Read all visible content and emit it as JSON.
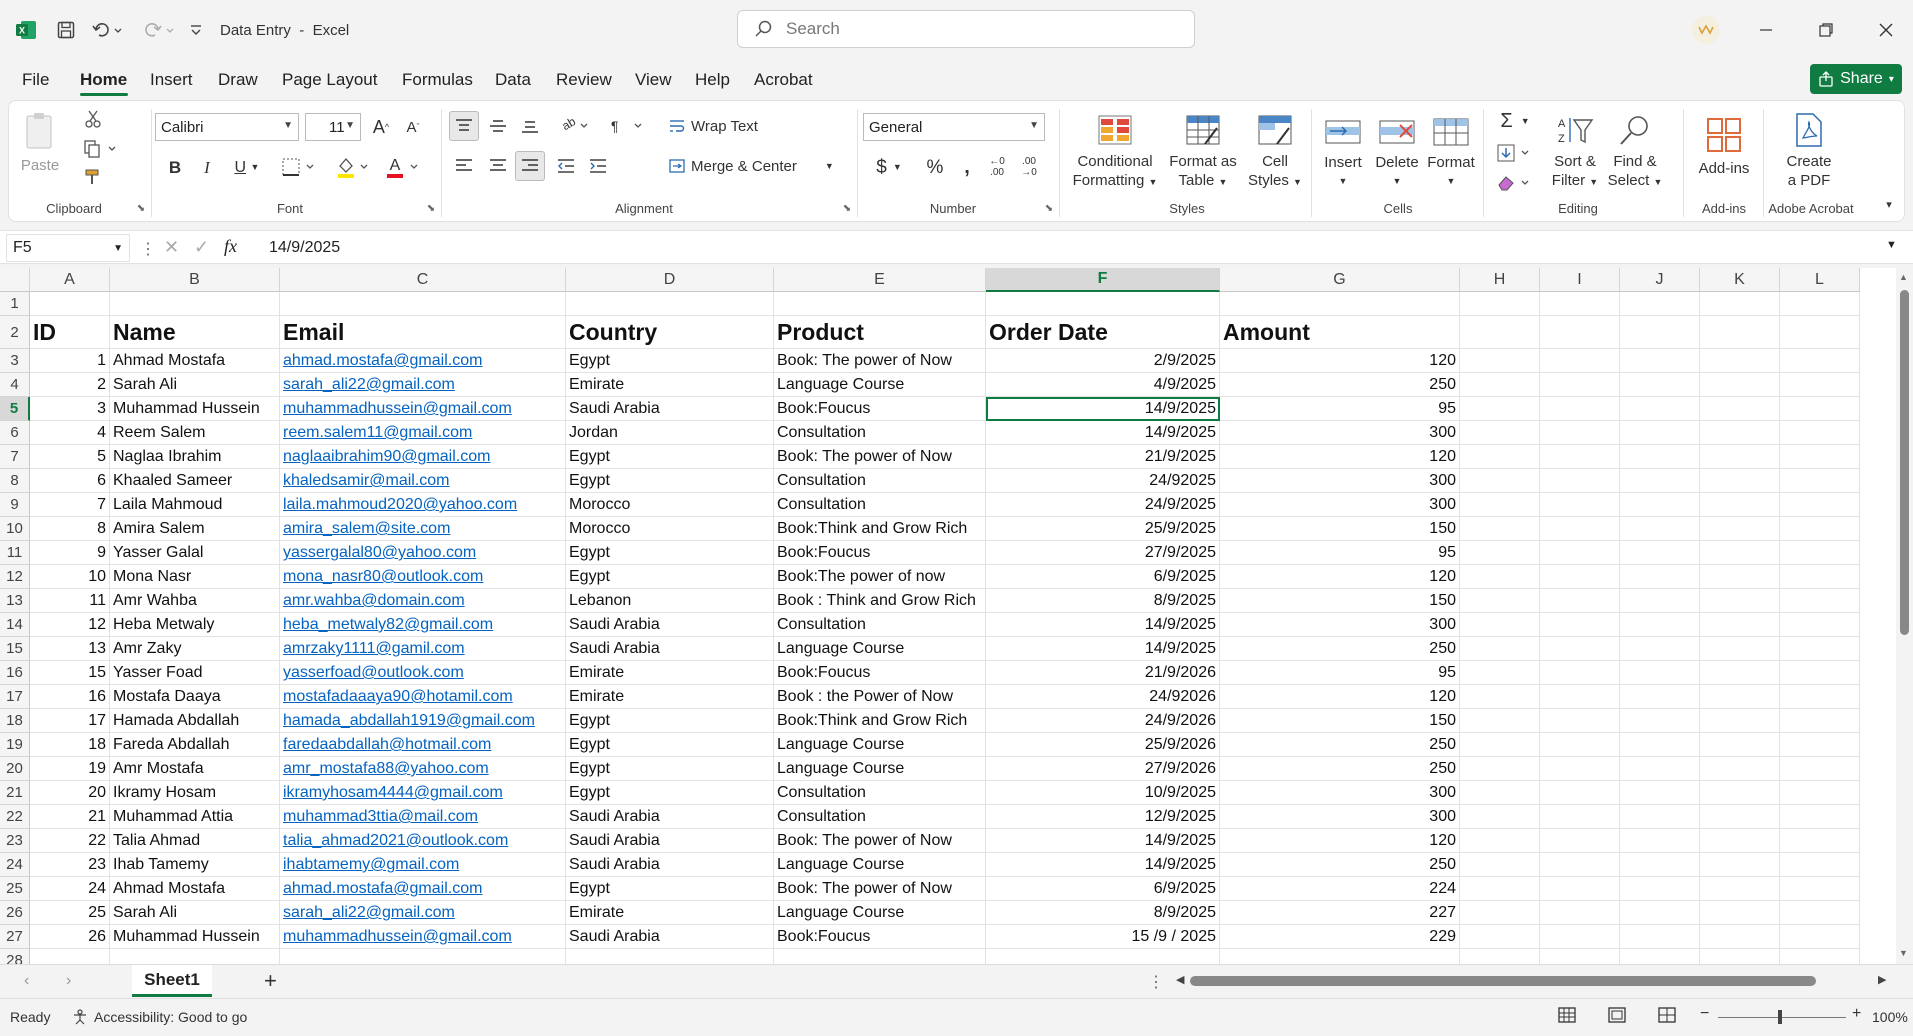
{
  "title_bar": {
    "doc_title": "Data Entry",
    "separator": "-",
    "app_name": "Excel",
    "search_placeholder": "Search"
  },
  "menu": {
    "tabs": [
      "File",
      "Home",
      "Insert",
      "Draw",
      "Page Layout",
      "Formulas",
      "Data",
      "Review",
      "View",
      "Help",
      "Acrobat"
    ],
    "active": "Home",
    "share_label": "Share"
  },
  "ribbon": {
    "clipboard": {
      "paste": "Paste",
      "label": "Clipboard"
    },
    "font": {
      "name": "Calibri",
      "size": "11",
      "label": "Font"
    },
    "alignment": {
      "wrap_text": "Wrap Text",
      "merge_center": "Merge & Center",
      "label": "Alignment"
    },
    "number": {
      "format": "General",
      "label": "Number"
    },
    "styles": {
      "conditional": "Conditional",
      "formatting": "Formatting",
      "format_as": "Format as",
      "table": "Table",
      "cell": "Cell",
      "styles_word": "Styles",
      "label": "Styles"
    },
    "cells": {
      "insert": "Insert",
      "delete": "Delete",
      "format": "Format",
      "label": "Cells"
    },
    "editing": {
      "sort": "Sort &",
      "filter": "Filter",
      "find": "Find &",
      "select": "Select",
      "label": "Editing"
    },
    "addins": {
      "addins": "Add-ins",
      "label": "Add-ins"
    },
    "acrobat": {
      "create": "Create",
      "pdf": "a PDF",
      "label": "Adobe Acrobat"
    }
  },
  "formula_bar": {
    "name_box": "F5",
    "fx": "fx",
    "formula": "14/9/2025"
  },
  "sheet": {
    "columns": [
      "A",
      "B",
      "C",
      "D",
      "E",
      "F",
      "G",
      "H",
      "I",
      "J",
      "K",
      "L"
    ],
    "selected_column": "F",
    "selected_row": 5,
    "header_row": [
      "ID",
      "Name",
      "Email",
      "Country",
      "Product",
      "Order Date",
      "Amount"
    ],
    "rows": [
      [
        "1",
        "Ahmad Mostafa",
        "ahmad.mostafa@gmail.com",
        "Egypt",
        "Book: The power of Now",
        "2/9/2025",
        "120"
      ],
      [
        "2",
        "Sarah Ali",
        "sarah_ali22@gmail.com",
        "Emirate",
        "Language Course",
        "4/9/2025",
        "250"
      ],
      [
        "3",
        "Muhammad Hussein",
        "muhammadhussein@gmail.com",
        "Saudi Arabia",
        "Book:Foucus",
        "14/9/2025",
        "95"
      ],
      [
        "4",
        "Reem Salem",
        "reem.salem11@gmail.com",
        "Jordan",
        "Consultation",
        "14/9/2025",
        "300"
      ],
      [
        "5",
        "Naglaa Ibrahim",
        "naglaaibrahim90@gmail.com",
        "Egypt",
        "Book: The power of Now",
        "21/9/2025",
        "120"
      ],
      [
        "6",
        "Khaaled Sameer",
        "khaledsamir@mail.com",
        "Egypt",
        "Consultation",
        "24/92025",
        "300"
      ],
      [
        "7",
        "Laila Mahmoud",
        "laila.mahmoud2020@yahoo.com",
        "Morocco",
        "Consultation",
        "24/9/2025",
        "300"
      ],
      [
        "8",
        "Amira Salem",
        "amira_salem@site.com",
        "Morocco",
        "Book:Think and Grow Rich",
        "25/9/2025",
        "150"
      ],
      [
        "9",
        "Yasser Galal",
        "yassergalal80@yahoo.com",
        "Egypt",
        "Book:Foucus",
        "27/9/2025",
        "95"
      ],
      [
        "10",
        "Mona Nasr",
        "mona_nasr80@outlook.com",
        "Egypt",
        "Book:The power of now",
        "6/9/2025",
        "120"
      ],
      [
        "11",
        "Amr Wahba",
        "amr.wahba@domain.com",
        "Lebanon",
        "Book : Think and Grow Rich",
        "8/9/2025",
        "150"
      ],
      [
        "12",
        "Heba Metwaly",
        "heba_metwaly82@gmail.com",
        "Saudi Arabia",
        "Consultation",
        "14/9/2025",
        "300"
      ],
      [
        "13",
        "Amr Zaky",
        "amrzaky1111@gamil.com",
        " Saudi Arabia",
        "Language Course",
        "14/9/2025",
        "250"
      ],
      [
        "15",
        "Yasser Foad",
        "yasserfoad@outlook.com",
        "Emirate",
        "Book:Foucus",
        "21/9/2026",
        "95"
      ],
      [
        "16",
        "Mostafa Daaya",
        "mostafadaaaya90@hotamil.com",
        "Emirate",
        "Book : the Power of Now",
        "24/92026",
        "120"
      ],
      [
        "17",
        "Hamada Abdallah",
        "hamada_abdallah1919@gmail.com",
        "Egypt",
        "Book:Think and Grow Rich",
        "24/9/2026",
        "150"
      ],
      [
        "18",
        "Fareda Abdallah",
        "faredaabdallah@hotmail.com",
        "Egypt",
        "Language Course",
        "25/9/2026",
        "250"
      ],
      [
        "19",
        "Amr Mostafa",
        "amr_mostafa88@yahoo.com",
        "Egypt",
        "Language Course",
        "27/9/2026",
        "250"
      ],
      [
        "20",
        "Ikramy Hosam",
        "ikramyhosam4444@gmail.com",
        "Egypt",
        "Consultation",
        "10/9/2025",
        "300"
      ],
      [
        "21",
        "Muhammad Attia",
        "muhammad3ttia@mail.com",
        " Saudi Arabia",
        "Consultation",
        "12/9/2025",
        "300"
      ],
      [
        "22",
        "Talia Ahmad",
        "talia_ahmad2021@outlook.com",
        " Saudi Arabia",
        "Book: The power of Now",
        "14/9/2025",
        "120"
      ],
      [
        "23",
        "Ihab Tamemy",
        "ihabtamemy@gmail.com",
        "Saudi Arabia",
        "Language Course",
        "14/9/2025",
        "250"
      ],
      [
        "24",
        "Ahmad Mostafa",
        "ahmad.mostafa@gmail.com",
        "Egypt",
        "Book: The power of Now",
        "6/9/2025",
        "224"
      ],
      [
        "25",
        "Sarah Ali",
        "sarah_ali22@gmail.com",
        "Emirate",
        "Language Course",
        "8/9/2025",
        "227"
      ],
      [
        "26",
        "Muhammad Hussein",
        "muhammadhussein@gmail.com",
        "Saudi Arabia",
        "Book:Foucus",
        "15 /9 / 2025",
        "229"
      ]
    ]
  },
  "sheet_tabs": {
    "active": "Sheet1",
    "add": "+"
  },
  "status": {
    "ready": "Ready",
    "accessibility": "Accessibility: Good to go",
    "zoom": "100%"
  },
  "colors": {
    "accent": "#107c41",
    "link": "#0563c1"
  }
}
